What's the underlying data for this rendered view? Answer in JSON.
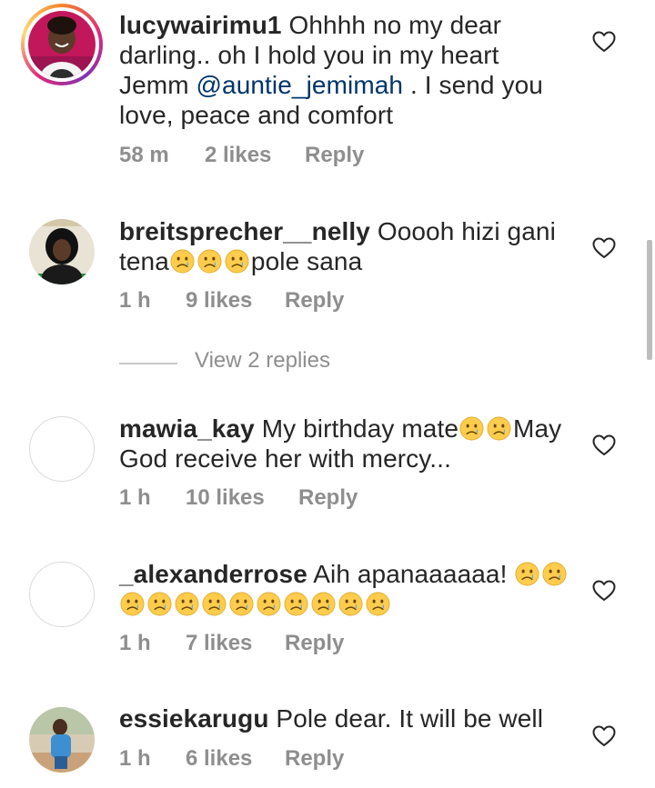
{
  "comments": [
    {
      "username": "lucywairimu1",
      "text_before": "Ohhhh no my dear darling.. oh I hold you in my heart Jemm ",
      "mention": "@auntie_jemimah",
      "text_after": " . I send you love, peace and comfort",
      "time": "58 m",
      "likes": "2 likes",
      "reply": "Reply",
      "avatar": "profile-photo",
      "has_story_ring": true
    },
    {
      "username": "breitsprecher__nelly",
      "text_before": "Ooooh hizi gani tena",
      "emoji_1": "crying-face",
      "emoji_count_1": 3,
      "text_after": "pole sana",
      "time": "1 h",
      "likes": "9 likes",
      "reply": "Reply",
      "avatar": "profile-photo"
    },
    {
      "username": "mawia_kay",
      "text_before": "My birthday mate",
      "emoji_1": "crying-face",
      "emoji_count_1": 2,
      "text_after": "May God receive her with mercy...",
      "time": "1 h",
      "likes": "10 likes",
      "reply": "Reply",
      "avatar": "default-avatar"
    },
    {
      "username": "_alexanderrose",
      "text_before": "Aih apanaaaaaa! ",
      "emoji_1": "crying-face",
      "emoji_count_1": 12,
      "time": "1 h",
      "likes": "7 likes",
      "reply": "Reply",
      "avatar": "default-avatar"
    },
    {
      "username": "essiekarugu",
      "text_before": "Pole dear. It will be well",
      "time": "1 h",
      "likes": "6 likes",
      "reply": "Reply",
      "avatar": "profile-photo"
    }
  ],
  "view_replies": "View 2 replies",
  "icons": {
    "like": "heart-outline-icon",
    "emoji": "crying-face-emoji"
  },
  "colors": {
    "text": "#262626",
    "meta": "#8e8e8e",
    "mention": "#003569",
    "emoji_face": "#ffcc4d",
    "emoji_tear": "#5dadec"
  }
}
